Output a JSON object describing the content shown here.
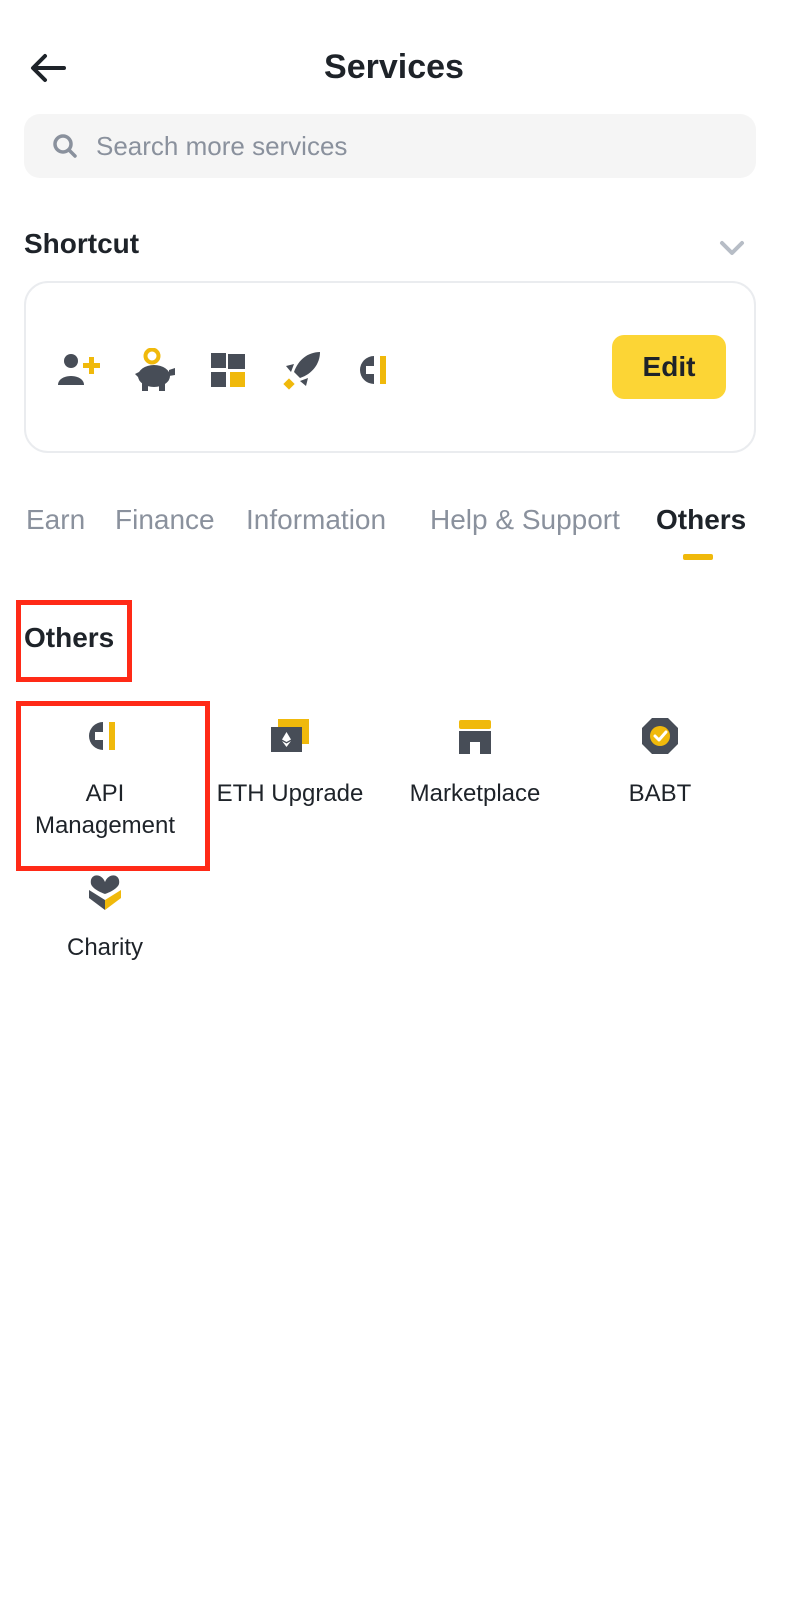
{
  "header": {
    "title": "Services",
    "back_icon": "arrow-left-icon"
  },
  "search": {
    "placeholder": "Search more services",
    "value": "",
    "icon": "search-icon"
  },
  "shortcut": {
    "title": "Shortcut",
    "chevron_icon": "chevron-down-icon",
    "icons": [
      "add-user-icon",
      "piggy-bank-icon",
      "widgets-icon",
      "rocket-icon",
      "api-plug-icon"
    ],
    "edit_label": "Edit"
  },
  "tabs": [
    {
      "label": "Earn",
      "active": false
    },
    {
      "label": "Finance",
      "active": false
    },
    {
      "label": "Information",
      "active": false
    },
    {
      "label": "Help & Support",
      "active": false
    },
    {
      "label": "Others",
      "active": true
    }
  ],
  "section": {
    "title": "Others",
    "items": [
      {
        "label": "API\nManagement",
        "icon": "api-plug-icon"
      },
      {
        "label": "ETH Upgrade",
        "icon": "eth-upgrade-icon"
      },
      {
        "label": "Marketplace",
        "icon": "marketplace-icon"
      },
      {
        "label": "BABT",
        "icon": "babt-badge-icon"
      },
      {
        "label": "Charity",
        "icon": "charity-heart-icon"
      }
    ]
  },
  "colors": {
    "accent": "#fcd535",
    "accent_dark": "#f0b90b",
    "icon_dark": "#474d57",
    "highlight": "#ff2a17"
  }
}
